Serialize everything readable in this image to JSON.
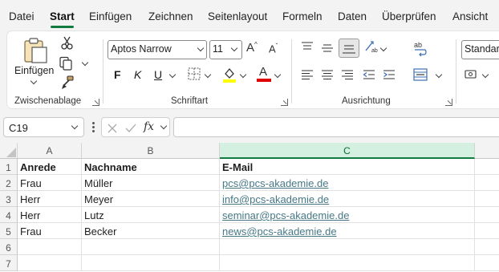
{
  "menu": {
    "tabs": [
      "Datei",
      "Start",
      "Einfügen",
      "Zeichnen",
      "Seitenlayout",
      "Formeln",
      "Daten",
      "Überprüfen",
      "Ansicht"
    ],
    "active_tab": "Start"
  },
  "ribbon": {
    "clipboard": {
      "paste_label": "Einfügen",
      "group_label": "Zwischenablage"
    },
    "font": {
      "font_name": "Aptos Narrow",
      "font_size": "11",
      "group_label": "Schriftart",
      "highlight_color": "#ffff00",
      "font_color": "#e00000"
    },
    "alignment": {
      "group_label": "Ausrichtung"
    },
    "number": {
      "format_value": "Standard"
    }
  },
  "formula_bar": {
    "name_box": "C19",
    "formula": "",
    "fx_label": "fx"
  },
  "sheet": {
    "columns": [
      "A",
      "B",
      "C"
    ],
    "selected_column": "C",
    "row_numbers": [
      "1",
      "2",
      "3",
      "4",
      "5",
      "6",
      "7"
    ],
    "header_row": {
      "a": "Anrede",
      "b": "Nachname",
      "c": "E-Mail"
    },
    "rows": [
      {
        "a": "Frau",
        "b": "Müller",
        "c": "pcs@pcs-akademie.de"
      },
      {
        "a": "Herr",
        "b": "Meyer",
        "c": "info@pcs-akademie.de"
      },
      {
        "a": "Herr",
        "b": "Lutz",
        "c": "seminar@pcs-akademie.de"
      },
      {
        "a": "Frau",
        "b": "Becker",
        "c": "news@pcs-akademie.de"
      }
    ]
  },
  "colors": {
    "accent_green": "#107c41",
    "link_color": "#467886"
  }
}
